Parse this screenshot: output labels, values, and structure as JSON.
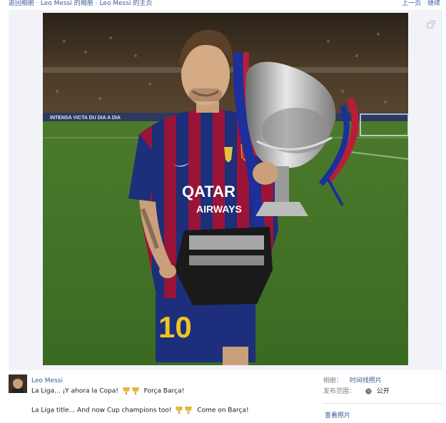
{
  "breadcrumb": {
    "items": [
      "返回相册",
      "Leo Messi 的相册",
      "Leo Messi 的主页"
    ],
    "separator": "·"
  },
  "pager": {
    "prev": "上一页",
    "next": "继续",
    "separator": "·"
  },
  "photo": {
    "banner_text": "INTENSA VICTA DU DIA A DIA",
    "shirt_text_1": "QATAR",
    "shirt_text_2": "AIRWAYS",
    "shorts_number": "10"
  },
  "post": {
    "owner": "Leo Messi",
    "caption_1_before": "La Liga... ¡Y ahora la Copa!",
    "caption_1_after": "Força Barça!",
    "caption_2_before": "La Liga title... And now Cup champions too!",
    "caption_2_after": "Come on Barça!"
  },
  "meta": {
    "album_label": "相册：",
    "album_value": "时间线照片",
    "privacy_label": "发布范围：",
    "privacy_value": "公开",
    "view_photo": "查看照片"
  },
  "icons": {
    "expand": "expand-icon",
    "globe": "globe-icon",
    "trophy": "trophy-emoji-icon"
  },
  "colors": {
    "link": "#3b5998",
    "stage_bg": "#f2f3f8",
    "barca_blue": "#1c3a8a",
    "barca_red": "#a1153a"
  }
}
